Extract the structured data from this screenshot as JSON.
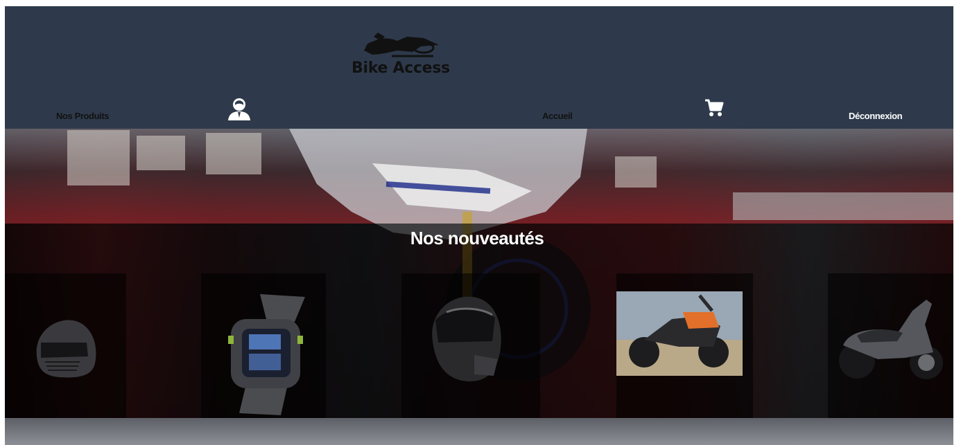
{
  "header": {
    "logo_text": "Bike Access",
    "nav": {
      "products_label": "Nos Produits",
      "home_label": "Accueil",
      "logout_label": "Déconnexion"
    },
    "icons": {
      "profile": "user-avatar-icon",
      "cart": "shopping-cart-icon"
    }
  },
  "hero": {
    "section_title": "Nos nouveautés",
    "products": [
      {
        "name": "helmet-matte-black",
        "icon": "helmet-icon"
      },
      {
        "name": "sports-watch",
        "icon": "watch-icon"
      },
      {
        "name": "helmet-gloss-black",
        "icon": "helmet-icon"
      },
      {
        "name": "adventure-motorcycle",
        "icon": "motorcycle-icon"
      },
      {
        "name": "scooter",
        "icon": "scooter-icon"
      }
    ]
  },
  "colors": {
    "header_bg": "#2e3a4b",
    "nav_text": "#111111",
    "nav_text_light": "#ffffff",
    "title_text": "#ffffff",
    "hero_red": "#6a2024"
  }
}
